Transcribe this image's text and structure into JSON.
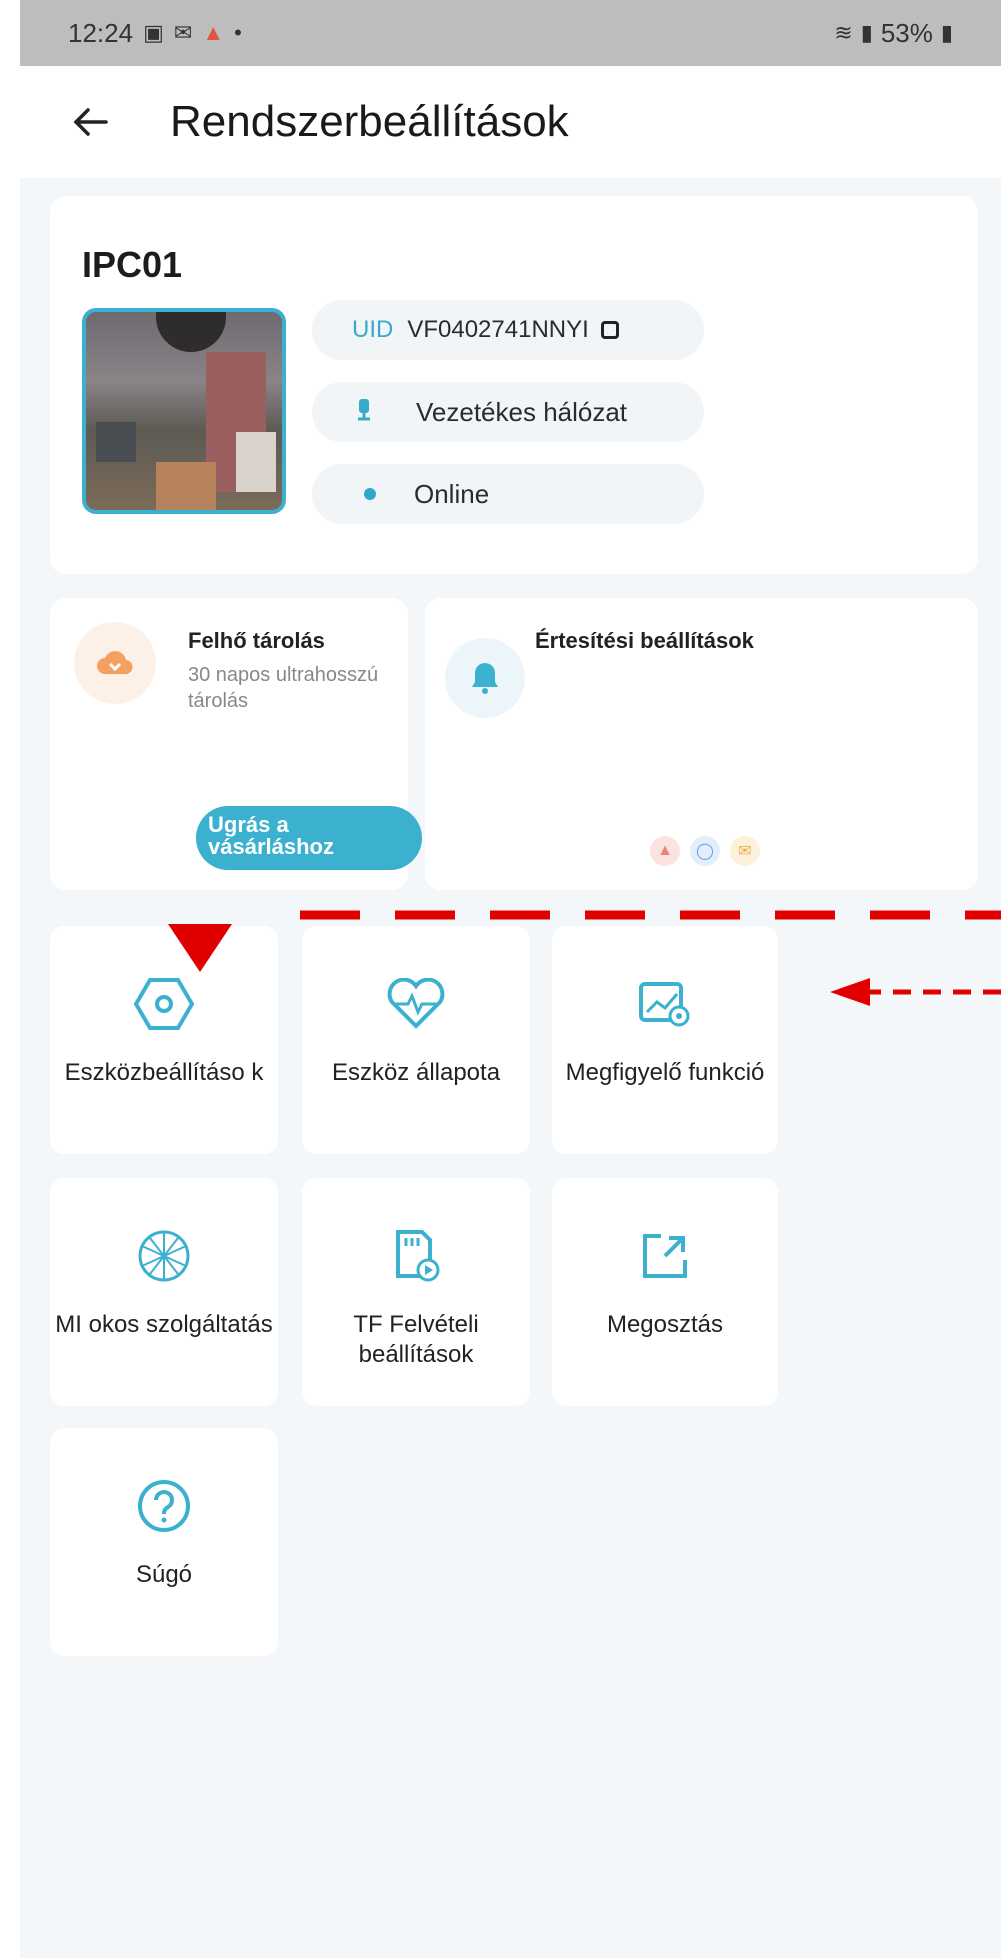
{
  "statusbar": {
    "time": "12:24",
    "battery": "53%"
  },
  "appbar": {
    "title": "Rendszerbeállítások"
  },
  "device": {
    "name": "IPC01",
    "uid_label": "UID",
    "uid_value": "VF0402741NNYI",
    "network": "Vezetékes hálózat",
    "status": "Online"
  },
  "cloud": {
    "title": "Felhő tárolás",
    "subtitle": "30 napos ultrahosszú tárolás",
    "button": "Ugrás a vásárláshoz"
  },
  "notifications": {
    "title": "Értesítési beállítások"
  },
  "grid": [
    {
      "label": "Eszközbeállításo k",
      "icon": "hexagon-settings-icon"
    },
    {
      "label": "Eszköz állapota",
      "icon": "heart-pulse-icon"
    },
    {
      "label": "Megfigyelő funkció",
      "icon": "monitor-chart-icon"
    },
    {
      "label": "MI okos szolgáltatás",
      "icon": "ai-network-icon"
    },
    {
      "label": "TF Felvételi beállítások",
      "icon": "sd-card-icon"
    },
    {
      "label": "Megosztás",
      "icon": "share-icon"
    },
    {
      "label": "Súgó",
      "icon": "help-icon"
    }
  ],
  "colors": {
    "accent": "#3bb0cf",
    "annotation": "#e00000",
    "background": "#f4f7fa"
  }
}
